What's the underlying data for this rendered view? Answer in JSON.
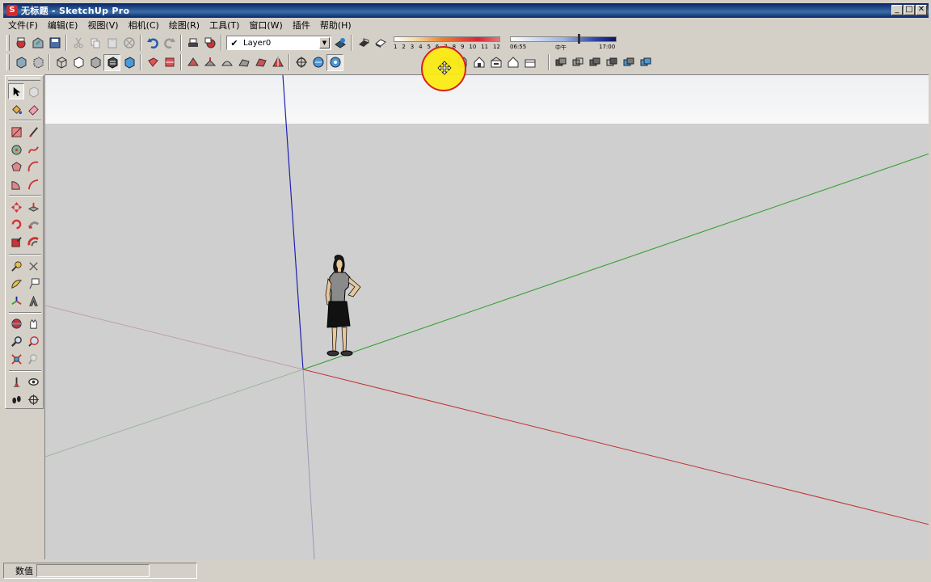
{
  "window": {
    "title": "无标题 - SketchUp Pro",
    "logo_glyph": "S",
    "minimize": "_",
    "maximize": "□",
    "close": "✕"
  },
  "menu": [
    "文件(F)",
    "编辑(E)",
    "视图(V)",
    "相机(C)",
    "绘图(R)",
    "工具(T)",
    "窗口(W)",
    "插件",
    "帮助(H)"
  ],
  "toolbar": {
    "layer_check": "✔",
    "layer_name": "Layer0",
    "layer_dropdown": "▼",
    "shadow_months": [
      "1",
      "2",
      "3",
      "4",
      "5",
      "6",
      "7",
      "8",
      "9",
      "10",
      "11",
      "12"
    ],
    "shadow_time_start": "06:55",
    "shadow_time_mid": "中午",
    "shadow_time_end": "17:00",
    "shadow_time_level": 0.64
  },
  "row1_icons": [
    "get-models-icon",
    "share-model-icon",
    "save-icon",
    "cut-icon",
    "copy-icon",
    "paste-icon",
    "erase-icon",
    "undo-icon",
    "redo-icon",
    "print-icon",
    "model-info-icon"
  ],
  "row2_icons": [
    "xray-icon",
    "back-edges-icon",
    "wireframe-icon",
    "hidden-line-icon",
    "shaded-icon",
    "shaded-textures-icon",
    "monochrome-icon",
    "section-plane-icon",
    "section-cut-icon",
    "sandbox-from-contours-icon",
    "sandbox-from-scratch-icon",
    "smoove-icon",
    "stamp-icon",
    "drape-icon",
    "add-detail-icon",
    "flip-edge-icon",
    "position-camera-icon",
    "walk-icon",
    "look-around-icon"
  ],
  "views_icons": [
    "iso-view-icon",
    "top-view-icon",
    "front-view-icon",
    "right-view-icon",
    "back-view-icon",
    "left-view-icon"
  ],
  "solid_icons": [
    "outer-shell-icon",
    "intersect-icon",
    "union-icon",
    "subtract-icon",
    "trim-icon",
    "split-icon"
  ],
  "left_tools": [
    "select-icon",
    "make-component-icon",
    "paint-bucket-icon",
    "eraser-icon",
    "rectangle-icon",
    "line-icon",
    "circle-icon",
    "arc-icon",
    "polygon-icon",
    "freehand-icon",
    "pie-icon",
    "two-point-arc-icon",
    "move-icon",
    "push-pull-icon",
    "rotate-icon",
    "follow-me-icon",
    "scale-icon",
    "offset-icon",
    "tape-measure-icon",
    "dimension-icon",
    "protractor-icon",
    "text-icon",
    "axes-icon",
    "3d-text-icon",
    "orbit-icon",
    "pan-icon",
    "zoom-icon",
    "zoom-window-icon",
    "zoom-extents-icon",
    "previous-view-icon",
    "position-camera-icon",
    "look-around-icon",
    "walk-icon",
    "section-plane-icon"
  ],
  "status": {
    "measurements_label": "数值",
    "measurements_value": ""
  },
  "colors": {
    "axis_red": "#c03030",
    "axis_green": "#30a030",
    "axis_blue": "#2020b0",
    "title_bar": "#0a246a",
    "highlight_fill": "#fae814",
    "highlight_ring": "#d82020"
  }
}
